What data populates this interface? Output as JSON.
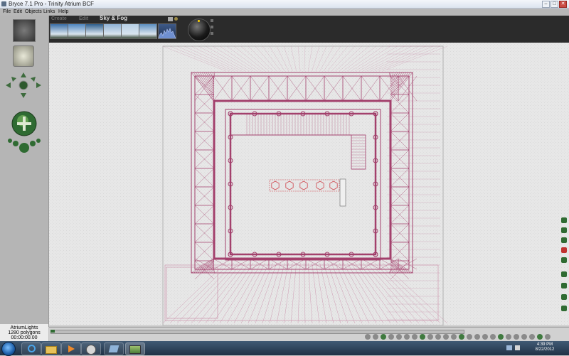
{
  "window": {
    "title": "Bryce 7.1  Pro - Trinity Atrium BCF"
  },
  "menu": [
    "File",
    "Edit",
    "Objects",
    "Links",
    "Help"
  ],
  "palette_tabs": {
    "create": "Create",
    "edit": "Edit",
    "sky": "Sky & Fog"
  },
  "sky_presets": [
    {
      "name": "sky-preset-1",
      "color": "#3a6ea5"
    },
    {
      "name": "sky-preset-2",
      "color": "#4f86bf"
    },
    {
      "name": "sky-preset-3",
      "color": "#2f5f8d"
    },
    {
      "name": "sky-preset-4",
      "color": "#8fb2d5"
    },
    {
      "name": "sky-preset-5",
      "color": "#b7cfe6"
    },
    {
      "name": "sky-preset-6",
      "color": "#5d8fc0"
    }
  ],
  "scene_info": {
    "object_name": "AtriumLights",
    "polygons": "1280 polygons",
    "time": "00:00:00.00"
  },
  "tray": {
    "time": "4:39 PM",
    "date": "8/22/2012"
  },
  "colors": {
    "wireframe": "#a3406c",
    "wireframe_light": "#c98aa6",
    "selection": "#d0474f",
    "canvas": "#e6e6e6"
  }
}
